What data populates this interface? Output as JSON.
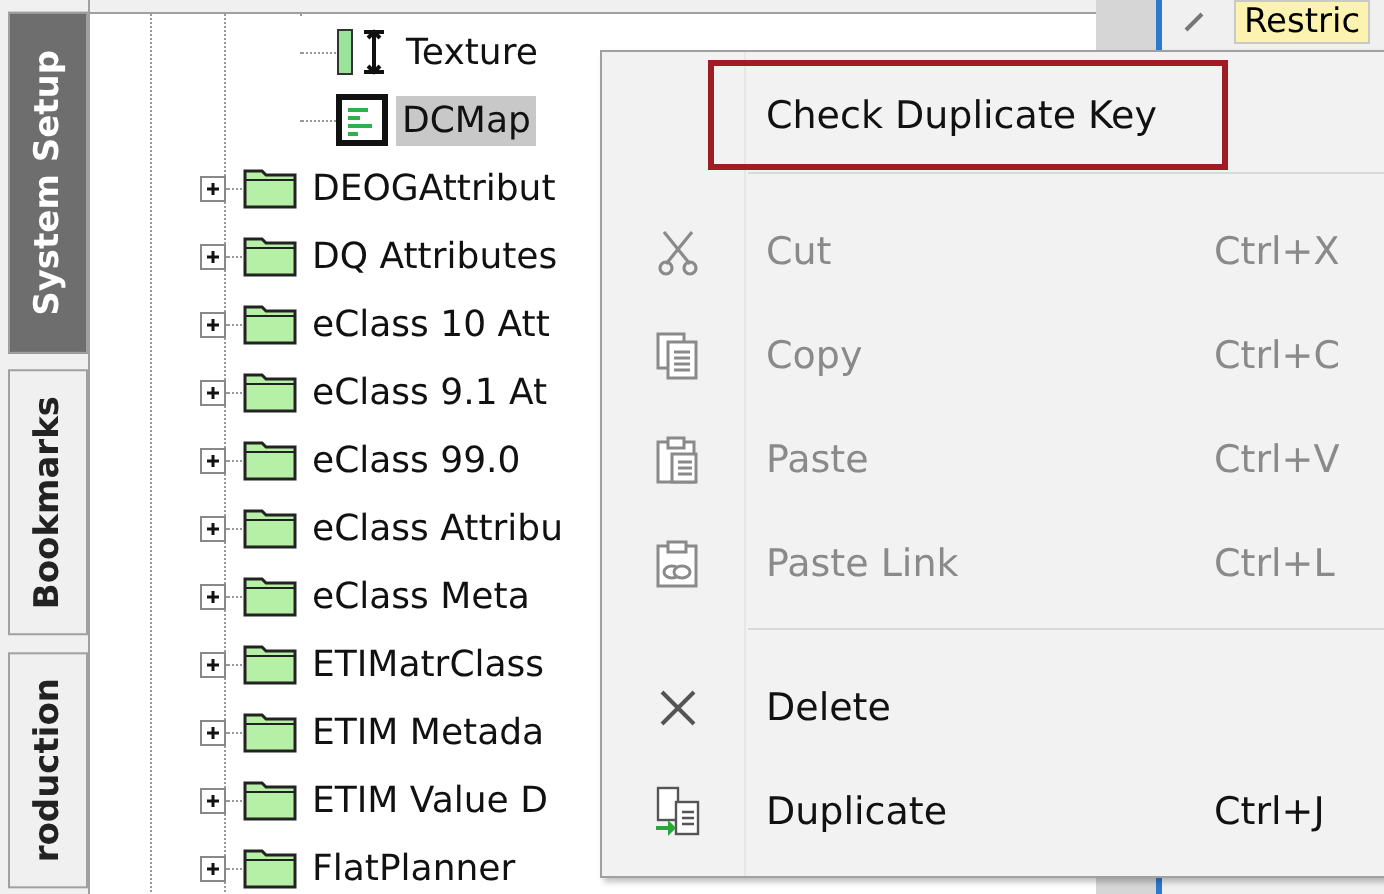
{
  "sidebar_tabs": [
    {
      "label": "System Setup",
      "selected": true
    },
    {
      "label": "Bookmarks",
      "selected": false
    },
    {
      "label": "roduction",
      "selected": false
    }
  ],
  "tree": {
    "child_items": [
      {
        "label": "Texture",
        "kind": "texture",
        "selected": false
      },
      {
        "label": "DCMap",
        "kind": "map",
        "selected": true
      }
    ],
    "items": [
      {
        "label": "DEOGAttribut",
        "expanded": false
      },
      {
        "label": "DQ Attributes",
        "expanded": false
      },
      {
        "label": "eClass 10 Att",
        "expanded": false
      },
      {
        "label": "eClass 9.1 At",
        "expanded": false
      },
      {
        "label": "eClass 99.0",
        "expanded": false
      },
      {
        "label": "eClass Attribu",
        "expanded": false
      },
      {
        "label": "eClass Meta",
        "expanded": false
      },
      {
        "label": "ETIMatrClass",
        "expanded": false
      },
      {
        "label": "ETIM Metada",
        "expanded": false
      },
      {
        "label": "ETIM Value D",
        "expanded": false
      },
      {
        "label": "FlatPlanner",
        "expanded": false
      }
    ]
  },
  "right_panel": {
    "field_value": "Restric"
  },
  "context_menu": {
    "items": [
      {
        "kind": "plain",
        "label": "Check Duplicate Key",
        "highlighted": true,
        "disabled": false
      },
      {
        "kind": "separator"
      },
      {
        "kind": "cut",
        "label": "Cut",
        "shortcut": "Ctrl+X",
        "highlighted": false,
        "disabled": true
      },
      {
        "kind": "copy",
        "label": "Copy",
        "shortcut": "Ctrl+C",
        "highlighted": false,
        "disabled": true
      },
      {
        "kind": "paste",
        "label": "Paste",
        "shortcut": "Ctrl+V",
        "highlighted": false,
        "disabled": true
      },
      {
        "kind": "paste-link",
        "label": "Paste Link",
        "shortcut": "Ctrl+L",
        "highlighted": false,
        "disabled": true
      },
      {
        "kind": "separator"
      },
      {
        "kind": "delete",
        "label": "Delete",
        "highlighted": false,
        "disabled": false
      },
      {
        "kind": "duplicate",
        "label": "Duplicate",
        "shortcut": "Ctrl+J",
        "highlighted": false,
        "disabled": false
      }
    ]
  }
}
